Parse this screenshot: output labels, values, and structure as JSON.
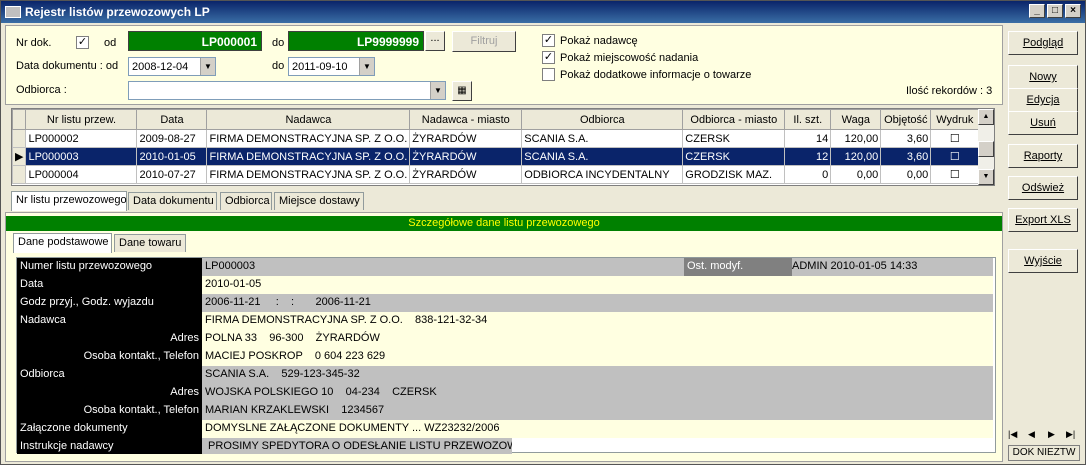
{
  "window": {
    "title": "Rejestr listów przewozowych LP"
  },
  "filter": {
    "nr_dok_label": "Nr dok.",
    "nr_dok_checked": "✓",
    "od_label": "od",
    "od_value": "LP000001",
    "do_label": "do",
    "do_value": "LP9999999",
    "ellipsis_label": "...",
    "filtruj_label": "Filtruj",
    "date_label": "Data dokumentu : od",
    "date_from": "2008-12-04",
    "date_do_label": "do",
    "date_to": "2011-09-10",
    "odbiorca_label": "Odbiorca :",
    "odbiorca_value": "",
    "opt_nadawca_label": "Pokaż nadawcę",
    "opt_nadawca_checked": "✓",
    "opt_miejscowosc_label": "Pokaż miejscowość nadania",
    "opt_miejscowosc_checked": "✓",
    "opt_towar_label": "Pokaż dodatkowe informacje o towarze",
    "opt_towar_checked": "",
    "record_count_label": "Ilość rekordów : 3"
  },
  "grid": {
    "columns": [
      "Nr listu przew.",
      "Data",
      "Nadawca",
      "Nadawca - miasto",
      "Odbiorca",
      "Odbiorca - miasto",
      "Il. szt.",
      "Waga",
      "Objętość",
      "Wydruk"
    ],
    "rows": [
      {
        "indicator": "",
        "nr": "LP000002",
        "data": "2009-08-27",
        "nadawca": "FIRMA DEMONSTRACYJNA SP. Z O.O.",
        "nadawca_miasto": "ŻYRARDÓW",
        "odbiorca": "SCANIA S.A.",
        "odbiorca_miasto": "CZERSK",
        "szt": "14",
        "waga": "120,00",
        "objetosc": "3,60",
        "wydruk": "☐"
      },
      {
        "indicator": "▶",
        "nr": "LP000003",
        "data": "2010-01-05",
        "nadawca": "FIRMA DEMONSTRACYJNA SP. Z O.O.",
        "nadawca_miasto": "ŻYRARDÓW",
        "odbiorca": "SCANIA S.A.",
        "odbiorca_miasto": "CZERSK",
        "szt": "12",
        "waga": "120,00",
        "objetosc": "3,60",
        "wydruk": "☐"
      },
      {
        "indicator": "",
        "nr": "LP000004",
        "data": "2010-07-27",
        "nadawca": "FIRMA DEMONSTRACYJNA SP. Z O.O.",
        "nadawca_miasto": "ŻYRARDÓW",
        "odbiorca": "ODBIORCA INCYDENTALNY",
        "odbiorca_miasto": "GRODZISK MAZ.",
        "szt": "0",
        "waga": "0,00",
        "objetosc": "0,00",
        "wydruk": "☐"
      }
    ]
  },
  "sort_tabs": [
    "Nr listu przewozowego",
    "Data dokumentu",
    "Odbiorca",
    "Miejsce dostawy"
  ],
  "detail": {
    "header": "Szczegółowe dane listu przewozowego",
    "tabs": [
      "Dane podstawowe",
      "Dane towaru"
    ],
    "rows": [
      {
        "label": "Numer listu przewozowego",
        "value": "LP000003"
      },
      {
        "label": "Data",
        "value": "2010-01-05"
      },
      {
        "label": "Godz przyj., Godz. wyjazdu",
        "value": "2006-11-21     :    :       2006-11-21"
      },
      {
        "label": "Nadawca",
        "value": "FIRMA DEMONSTRACYJNA SP. Z O.O.    838-121-32-34"
      },
      {
        "label": "Adres",
        "value": "POLNA 33    96-300    ŻYRARDÓW"
      },
      {
        "label": "Osoba kontakt., Telefon",
        "value": "MACIEJ POSKROP    0 604 223 629"
      },
      {
        "label": "Odbiorca",
        "value": "SCANIA S.A.    529-123-345-32"
      },
      {
        "label": "Adres",
        "value": "WOJSKA POLSKIEGO 10    04-234    CZERSK"
      },
      {
        "label": "Osoba kontakt., Telefon",
        "value": "MARIAN KRZAKLEWSKI    1234567"
      },
      {
        "label": "Załączone dokumenty",
        "value": "DOMYSLNE ZAŁĄCZONE DOKUMENTY ... WZ23232/2006"
      },
      {
        "label": "Instrukcje nadawcy",
        "value": " PROSIMY SPEDYTORA O ODESŁANIE LISTU PRZEWOZOWEG"
      }
    ],
    "modified_label": "Ost. modyf.",
    "modified_value": "ADMIN 2010-01-05 14:33"
  },
  "sidebar": {
    "buttons": [
      "Podgląd",
      "Nowy",
      "Edycja",
      "Usuń",
      "Raporty",
      "Odśwież",
      "Export XLS",
      "Wyjście"
    ],
    "nav": [
      "|◀",
      "◀",
      "▶",
      "▶|"
    ],
    "status": "DOK NIEZTW"
  }
}
